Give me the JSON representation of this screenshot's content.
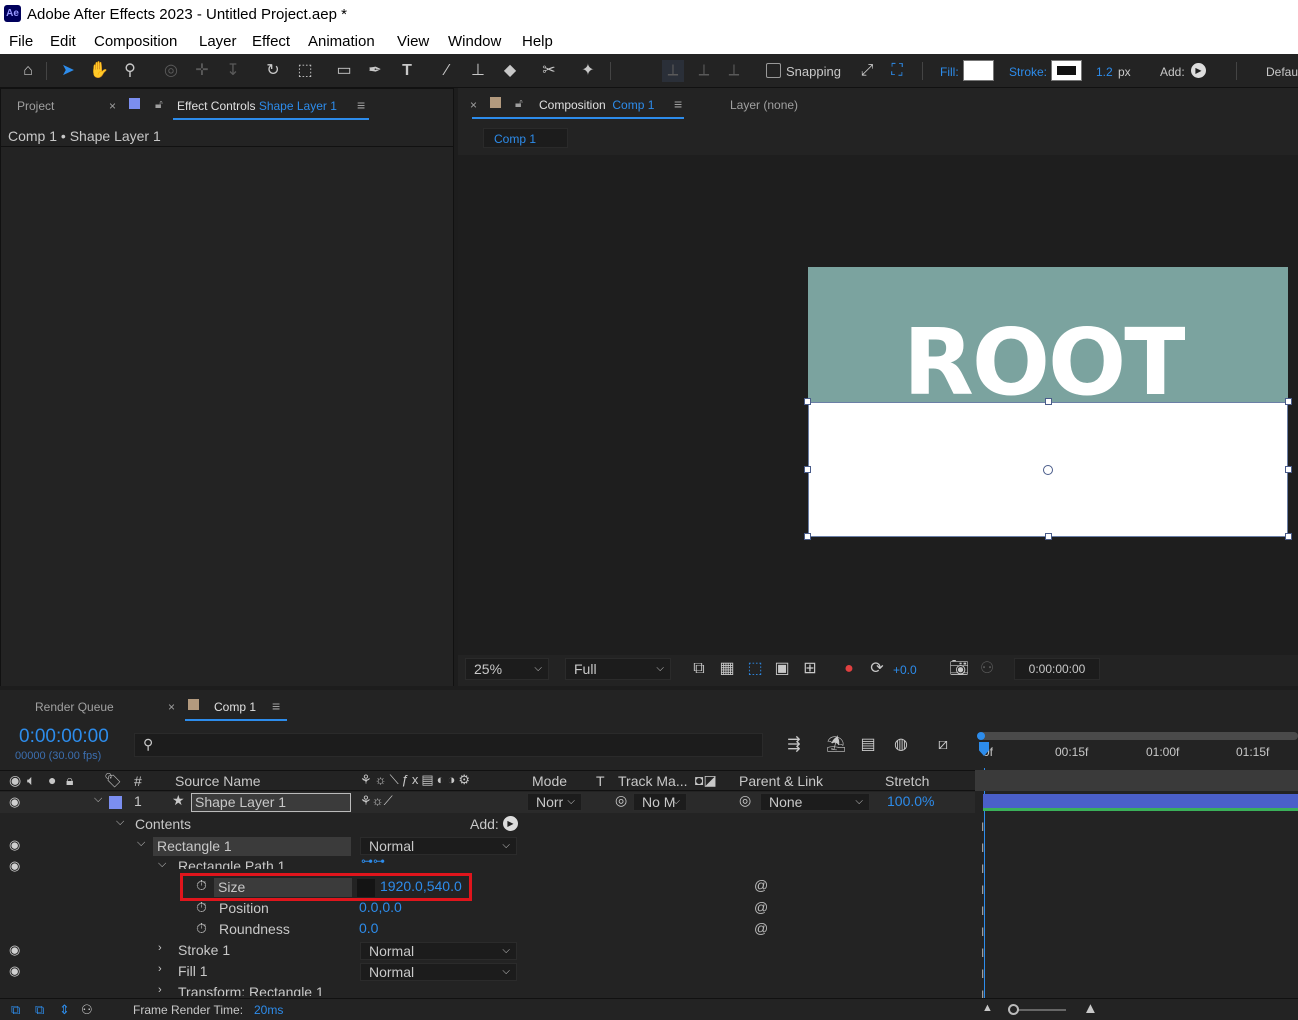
{
  "app": {
    "logo": "Ae",
    "title": "Adobe After Effects 2023 - Untitled Project.aep *"
  },
  "menu": [
    "File",
    "Edit",
    "Composition",
    "Layer",
    "Effect",
    "Animation",
    "View",
    "Window",
    "Help"
  ],
  "toolbar": {
    "snapping_label": "Snapping",
    "fill_label": "Fill:",
    "stroke_label": "Stroke:",
    "stroke_width": "1.2",
    "stroke_unit": "px",
    "add_label": "Add:",
    "workspace": "Defau"
  },
  "left_panel": {
    "tab_project": "Project",
    "tab_effect_controls": "Effect Controls",
    "effect_layer": "Shape Layer 1",
    "breadcrumb": "Comp 1 • Shape Layer 1"
  },
  "viewer": {
    "tab_composition": "Composition",
    "comp_name": "Comp 1",
    "tab_layer": "Layer (none)",
    "subtab": "Comp 1",
    "canvas_text": "ROOT",
    "zoom": "25%",
    "resolution": "Full",
    "exposure": "+0.0",
    "timecode": "0:00:00:00"
  },
  "timeline": {
    "tab_render_queue": "Render Queue",
    "tab_comp": "Comp 1",
    "current_time": "0:00:00:00",
    "frame_info": "00000 (30.00 fps)",
    "search_placeholder": "",
    "headers": {
      "num": "#",
      "source_name": "Source Name",
      "mode": "Mode",
      "t": "T",
      "track_matte": "Track Ma...",
      "parent": "Parent & Link",
      "stretch": "Stretch"
    },
    "ruler": [
      "0f",
      "00:15f",
      "01:00f",
      "01:15f"
    ],
    "layer": {
      "num": "1",
      "name": "Shape Layer 1",
      "mode": "Norr",
      "track": "No M",
      "parent": "None",
      "stretch": "100.0%"
    },
    "contents_label": "Contents",
    "add_label": "Add:",
    "rect_group": "Rectangle 1",
    "rect_mode": "Normal",
    "rect_path": "Rectangle Path 1",
    "props": [
      {
        "name": "Size",
        "value": "1920.0,540.0"
      },
      {
        "name": "Position",
        "value": "0.0,0.0"
      },
      {
        "name": "Roundness",
        "value": "0.0"
      }
    ],
    "stroke": {
      "name": "Stroke 1",
      "mode": "Normal"
    },
    "fill": {
      "name": "Fill 1",
      "mode": "Normal"
    },
    "transform": "Transform: Rectangle 1",
    "render_time_label": "Frame Render Time:",
    "render_time_value": "20ms"
  },
  "colors": {
    "accent": "#2d8ceb",
    "teal_bg": "#7ba39f",
    "highlight_box": "#e0151c"
  }
}
